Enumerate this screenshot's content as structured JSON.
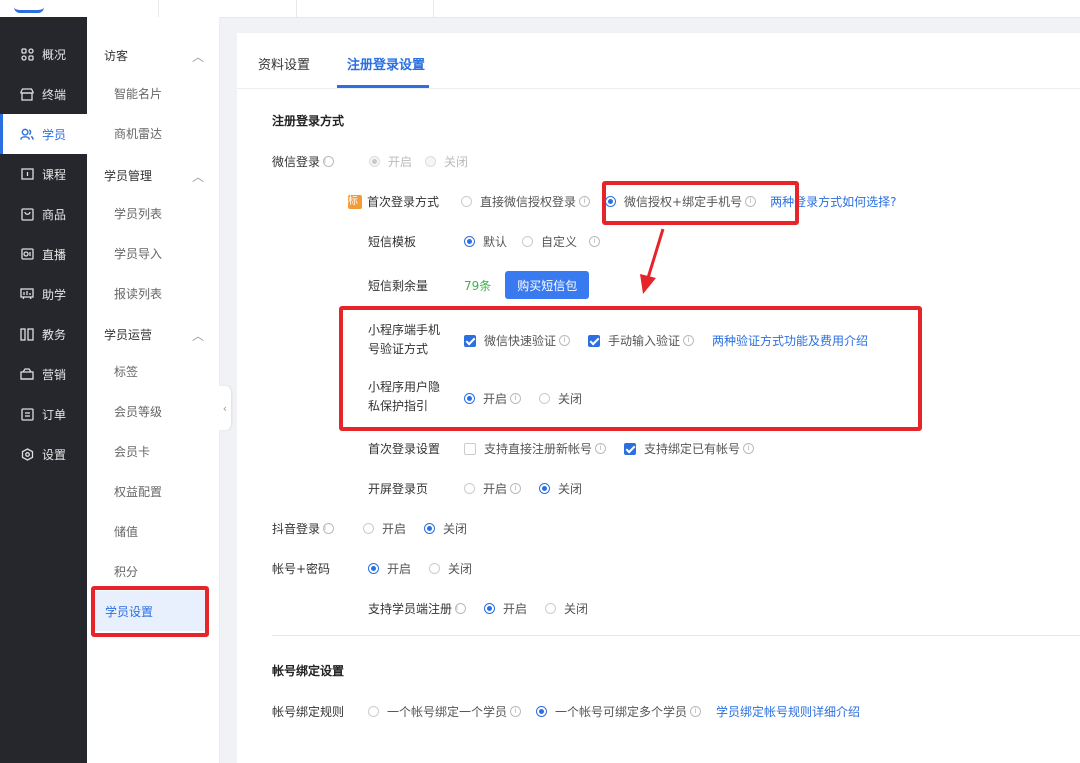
{
  "nav": {
    "items": [
      {
        "label": "概况",
        "icon": "grid-icon"
      },
      {
        "label": "终端",
        "icon": "store-icon"
      },
      {
        "label": "学员",
        "icon": "users-icon"
      },
      {
        "label": "课程",
        "icon": "course-icon"
      },
      {
        "label": "商品",
        "icon": "goods-icon"
      },
      {
        "label": "直播",
        "icon": "live-icon"
      },
      {
        "label": "助学",
        "icon": "assist-icon"
      },
      {
        "label": "教务",
        "icon": "academic-icon"
      },
      {
        "label": "营销",
        "icon": "marketing-icon"
      },
      {
        "label": "订单",
        "icon": "order-icon"
      },
      {
        "label": "设置",
        "icon": "gear-icon"
      }
    ]
  },
  "subnav": {
    "visitor": {
      "title": "访客",
      "items": [
        "智能名片",
        "商机雷达"
      ]
    },
    "manage": {
      "title": "学员管理",
      "items": [
        "学员列表",
        "学员导入",
        "报读列表"
      ]
    },
    "ops": {
      "title": "学员运营",
      "items": [
        "标签",
        "会员等级",
        "会员卡",
        "权益配置",
        "储值",
        "积分",
        "学员设置"
      ]
    }
  },
  "tabs": [
    "资料设置",
    "注册登录设置"
  ],
  "sections": {
    "login_title": "注册登录方式",
    "binding_title": "帐号绑定设置"
  },
  "wechat": {
    "label": "微信登录",
    "on": "开启",
    "off": "关闭",
    "first_login": {
      "tag": "标",
      "label": "首次登录方式",
      "opt1": "直接微信授权登录",
      "opt2": "微信授权+绑定手机号",
      "link": "两种登录方式如何选择?"
    },
    "sms_template": {
      "label": "短信模板",
      "opt1": "默认",
      "opt2": "自定义"
    },
    "sms_remain": {
      "label": "短信剩余量",
      "value": "79条",
      "button": "购买短信包"
    },
    "mini_verify": {
      "label_line1": "小程序端手机",
      "label_line2": "号验证方式",
      "opt1": "微信快速验证",
      "opt2": "手动输入验证",
      "link": "两种验证方式功能及费用介绍"
    },
    "mini_privacy": {
      "label_line1": "小程序用户隐",
      "label_line2": "私保护指引",
      "on": "开启",
      "off": "关闭"
    },
    "first_settings": {
      "label": "首次登录设置",
      "opt1": "支持直接注册新帐号",
      "opt2": "支持绑定已有帐号"
    },
    "splash": {
      "label": "开屏登录页",
      "on": "开启",
      "off": "关闭"
    }
  },
  "douyin": {
    "label": "抖音登录",
    "on": "开启",
    "off": "关闭"
  },
  "account": {
    "label": "帐号+密码",
    "on": "开启",
    "off": "关闭",
    "register": {
      "label": "支持学员端注册",
      "on": "开启",
      "off": "关闭"
    }
  },
  "binding": {
    "label": "帐号绑定规则",
    "opt1": "一个帐号绑定一个学员",
    "opt2": "一个帐号可绑定多个学员",
    "link": "学员绑定帐号规则详细介绍"
  },
  "colors": {
    "accent": "#2b6fe0",
    "highlight": "#e6252a",
    "nav_bg": "#25272d",
    "sms_count": "#3bb54a"
  }
}
